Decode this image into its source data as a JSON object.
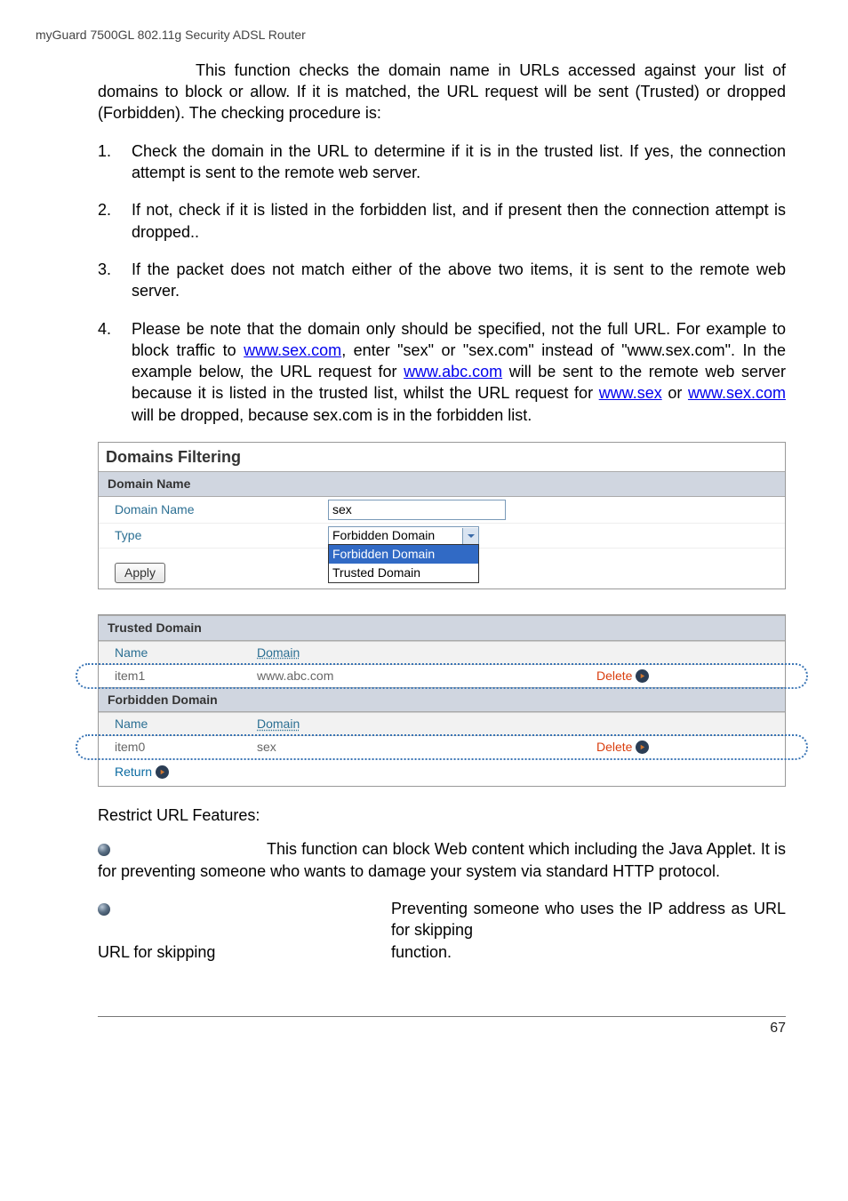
{
  "header": "myGuard 7500GL 802.11g Security ADSL Router",
  "intro": {
    "para1_pre": "This function checks the domain name in URLs accessed against your list of domains to block or allow. If it is matched, the URL request will be sent (Trusted) or dropped (Forbidden). The checking procedure is:",
    "items": [
      "Check the domain in the URL to determine if it is in the trusted list. If yes, the connection attempt is sent to the remote web server.",
      "If not, check if it is listed in the forbidden list, and if present then the connection attempt is dropped..",
      "If the packet does not match either of the above two items, it is sent to the remote web server."
    ],
    "item4_pre": "Please be note that the domain only should be specified, not the full URL. For example to block traffic to ",
    "link_sexcom": "www.sex.com",
    "item4_mid1": ", enter \"sex\" or \"sex.com\" instead of \"www.sex.com\". In the example below, the URL request for ",
    "link_abc": "www.abc.com",
    "item4_mid2": " will be sent to the remote web server because it is listed in the trusted list, whilst the URL request for ",
    "link_sex": "www.sex",
    "item4_or": " or ",
    "link_sexcom2": "www.sex.com",
    "item4_end": " will be dropped, because sex.com is in the forbidden list."
  },
  "panel": {
    "title": "Domains Filtering",
    "section": "Domain Name",
    "row_domain_label": "Domain Name",
    "row_domain_value": "sex",
    "row_type_label": "Type",
    "row_type_value": "Forbidden Domain",
    "type_options": [
      "Forbidden Domain",
      "Trusted Domain"
    ],
    "apply": "Apply"
  },
  "trusted": {
    "section": "Trusted Domain",
    "head_name": "Name",
    "head_domain": "Domain",
    "row_name": "item1",
    "row_domain": "www.abc.com",
    "delete": "Delete"
  },
  "forbidden": {
    "section": "Forbidden Domain",
    "head_name": "Name",
    "head_domain": "Domain",
    "row_name": "item0",
    "row_domain": "sex",
    "delete": "Delete"
  },
  "return": "Return",
  "restrict": {
    "heading": "Restrict URL Features:",
    "b1": "This function can block Web content which including the Java Applet. It is for preventing someone who wants to damage your system via standard HTTP protocol.",
    "b2_a": "Preventing someone who uses the IP address as URL for skipping",
    "b2_b": "function."
  },
  "page_number": "67",
  "chart_data": {
    "type": "table",
    "tables": [
      {
        "title": "Trusted Domain",
        "columns": [
          "Name",
          "Domain"
        ],
        "rows": [
          [
            "item1",
            "www.abc.com"
          ]
        ]
      },
      {
        "title": "Forbidden Domain",
        "columns": [
          "Name",
          "Domain"
        ],
        "rows": [
          [
            "item0",
            "sex"
          ]
        ]
      }
    ]
  }
}
